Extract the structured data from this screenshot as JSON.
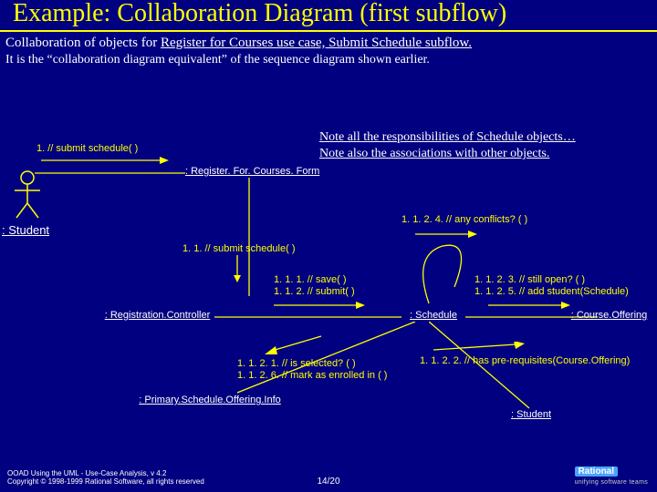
{
  "title": "Example: Collaboration Diagram  (first subflow)",
  "subtitle_prefix": "Collaboration of objects for ",
  "subtitle_underlined": "Register for Courses use case, Submit Schedule subflow.",
  "note": "It is the “collaboration diagram equivalent” of the sequence diagram shown earlier.",
  "resp_note_1": "Note all the responsibilities of Schedule objects…",
  "resp_note_2": "Note also the associations with other objects.",
  "actor_student": ": Student",
  "obj_form": ": Register. For. Courses. Form",
  "obj_controller": ":  Registration.Controller",
  "obj_schedule": ":  Schedule",
  "obj_offering": ":  Course.Offering",
  "obj_primary": ":  Primary.Schedule.Offering.Info",
  "obj_student2": ": Student",
  "msg_1": "1. // submit schedule( )",
  "msg_1_1": "1. 1. // submit schedule( )",
  "msg_1_1_1": "1. 1. 1. // save( )",
  "msg_1_1_2": "1. 1. 2. // submit( )",
  "msg_1_1_2_1": "1. 1. 2. 1. // is selected? ( )",
  "msg_1_1_2_6": "1. 1. 2. 6. // mark as enrolled in ( )",
  "msg_1_1_2_2": "1. 1. 2. 2. // has pre-requisites(Course.Offering)",
  "msg_1_1_2_3": "1. 1. 2. 3. // still open? ( )",
  "msg_1_1_2_5": "1. 1. 2. 5. // add student(Schedule)",
  "msg_1_1_2_4": "1. 1. 2. 4. // any conflicts? ( )",
  "footer_1": "OOAD Using the UML - Use-Case Analysis, v 4.2",
  "footer_2": "Copyright © 1998-1999 Rational Software, all rights reserved",
  "slidenum": "14/20",
  "logo_main": "Rational",
  "logo_tag": "unifying software teams"
}
